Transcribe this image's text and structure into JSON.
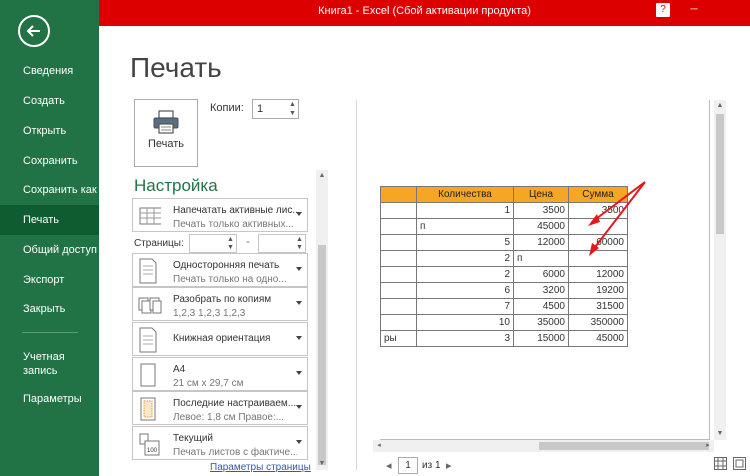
{
  "window": {
    "title": "Книга1 -  Excel (Сбой активации продукта)",
    "help": "?",
    "minimize": "─"
  },
  "nav": {
    "items": [
      "Сведения",
      "Создать",
      "Открыть",
      "Сохранить",
      "Сохранить как",
      "Печать",
      "Общий доступ",
      "Экспорт",
      "Закрыть"
    ],
    "account": "Учетная запись",
    "options": "Параметры",
    "active": "Печать"
  },
  "page_title": "Печать",
  "print_button": "Печать",
  "copies": {
    "label": "Копии:",
    "value": "1"
  },
  "settings": {
    "title": "Настройка",
    "pages_label": "Страницы:",
    "pages_dash": "-",
    "options": [
      {
        "line1": "Напечатать активные лис...",
        "line2": "Печать только активных..."
      },
      {
        "line1": "Односторонняя печать",
        "line2": "Печать только на одно..."
      },
      {
        "line1": "Разобрать по копиям",
        "line2": "1,2,3    1,2,3    1,2,3"
      },
      {
        "line1": "Книжная ориентация",
        "line2": ""
      },
      {
        "line1": "А4",
        "line2": "21 см x 29,7 см"
      },
      {
        "line1": "Последние настраиваем...",
        "line2": "Левое:  1,8 см    Правое:..."
      },
      {
        "line1": "Текущий",
        "line2": "Печать листов с фактиче..."
      }
    ],
    "page_setup_link": "Параметры страницы"
  },
  "preview": {
    "headers": [
      "",
      "Количества",
      "Цена",
      "Сумма"
    ],
    "rows": [
      [
        "",
        "1",
        "3500",
        "3500"
      ],
      [
        "",
        "п",
        "45000",
        ""
      ],
      [
        "",
        "5",
        "12000",
        "60000"
      ],
      [
        "",
        "2",
        "п",
        ""
      ],
      [
        "",
        "2",
        "6000",
        "12000"
      ],
      [
        "",
        "6",
        "3200",
        "19200"
      ],
      [
        "",
        "7",
        "4500",
        "31500"
      ],
      [
        "",
        "10",
        "35000",
        "350000"
      ],
      [
        "ры",
        "3",
        "15000",
        "45000"
      ]
    ],
    "header_color": "#f5a623",
    "arrow_color": "#e8161b"
  },
  "page_nav": {
    "current": "1",
    "of": "из 1",
    "prev": "◂",
    "next": "▸"
  },
  "colors": {
    "nav_bg": "#217346",
    "nav_active": "#0e5c2f",
    "titlebar": "#dd0000"
  }
}
